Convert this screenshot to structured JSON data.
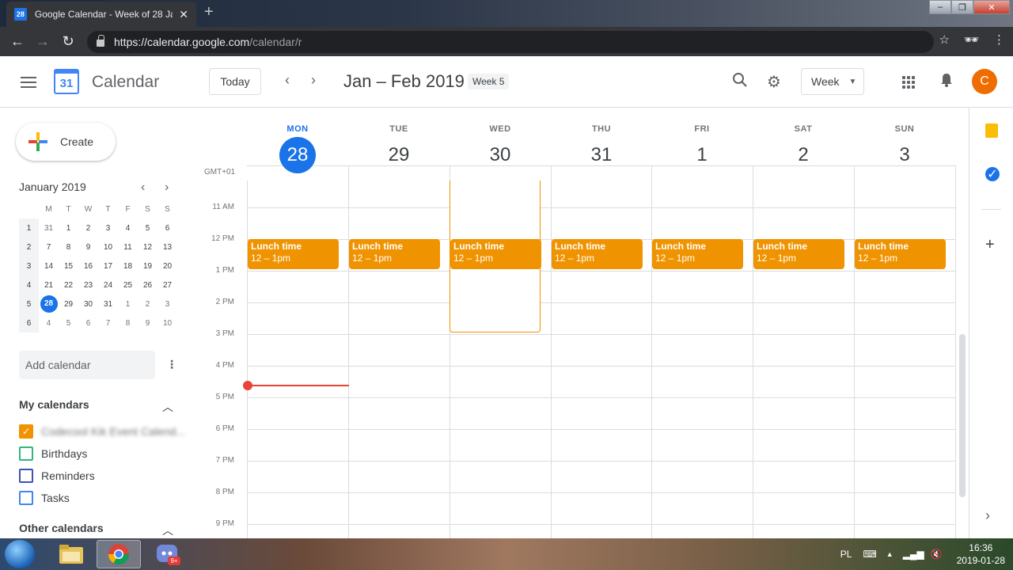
{
  "browser": {
    "tab_title": "Google Calendar - Week of 28 Ja",
    "favicon_text": "28",
    "url_host": "https://calendar.google.com",
    "url_path": "/calendar/r"
  },
  "header": {
    "app_name": "Calendar",
    "logo_day": "31",
    "today_label": "Today",
    "range_title": "Jan – Feb 2019",
    "week_badge": "Week 5",
    "view_label": "Week",
    "avatar_initial": "C"
  },
  "sidebar": {
    "create_label": "Create",
    "mini_title": "January 2019",
    "dow": [
      "M",
      "T",
      "W",
      "T",
      "F",
      "S",
      "S"
    ],
    "weeks": [
      {
        "wk": "1",
        "days": [
          "31",
          "1",
          "2",
          "3",
          "4",
          "5",
          "6"
        ]
      },
      {
        "wk": "2",
        "days": [
          "7",
          "8",
          "9",
          "10",
          "11",
          "12",
          "13"
        ]
      },
      {
        "wk": "3",
        "days": [
          "14",
          "15",
          "16",
          "17",
          "18",
          "19",
          "20"
        ]
      },
      {
        "wk": "4",
        "days": [
          "21",
          "22",
          "23",
          "24",
          "25",
          "26",
          "27"
        ]
      },
      {
        "wk": "5",
        "days": [
          "28",
          "29",
          "30",
          "31",
          "1",
          "2",
          "3"
        ]
      },
      {
        "wk": "6",
        "days": [
          "4",
          "5",
          "6",
          "7",
          "8",
          "9",
          "10"
        ]
      }
    ],
    "add_calendar_placeholder": "Add calendar",
    "my_calendars_title": "My calendars",
    "my_calendars": [
      {
        "label": "Codecool Kik Event Calend...",
        "color": "#f09300",
        "checked": true,
        "blurred": true
      },
      {
        "label": "Birthdays",
        "color": "#33b679",
        "checked": false,
        "blurred": false
      },
      {
        "label": "Reminders",
        "color": "#3f51b5",
        "checked": false,
        "blurred": false
      },
      {
        "label": "Tasks",
        "color": "#4285f4",
        "checked": false,
        "blurred": false
      }
    ],
    "other_calendars_title": "Other calendars"
  },
  "week": {
    "timezone_label": "GMT+01",
    "days": [
      {
        "name": "MON",
        "num": "28",
        "today": true
      },
      {
        "name": "TUE",
        "num": "29",
        "today": false
      },
      {
        "name": "WED",
        "num": "30",
        "today": false
      },
      {
        "name": "THU",
        "num": "31",
        "today": false
      },
      {
        "name": "FRI",
        "num": "1",
        "today": false
      },
      {
        "name": "SAT",
        "num": "2",
        "today": false
      },
      {
        "name": "SUN",
        "num": "3",
        "today": false
      }
    ],
    "hours": [
      "11 AM",
      "12 PM",
      "1 PM",
      "2 PM",
      "3 PM",
      "4 PM",
      "5 PM",
      "6 PM",
      "7 PM",
      "8 PM",
      "9 PM"
    ],
    "events": [
      {
        "title": "Lunch time",
        "time": "12 – 1pm",
        "day": 0
      },
      {
        "title": "Lunch time",
        "time": "12 – 1pm",
        "day": 1
      },
      {
        "title": "Lunch time",
        "time": "12 – 1pm",
        "day": 2
      },
      {
        "title": "Lunch time",
        "time": "12 – 1pm",
        "day": 3
      },
      {
        "title": "Lunch time",
        "time": "12 – 1pm",
        "day": 4
      },
      {
        "title": "Lunch time",
        "time": "12 – 1pm",
        "day": 5
      },
      {
        "title": "Lunch time",
        "time": "12 – 1pm",
        "day": 6
      }
    ],
    "event_color": "#f09300",
    "now_color": "#ea4335"
  },
  "taskbar": {
    "lang": "PL",
    "time": "16:36",
    "date": "2019-01-28",
    "discord_badge": "9+"
  },
  "icons": {
    "back": "←",
    "forward": "→",
    "reload": "↻",
    "star": "☆",
    "more": "⋮",
    "search": "🔍",
    "settings": "⚙",
    "bell": "🔔",
    "chev_left": "‹",
    "chev_right": "›",
    "caret_up": "⌃",
    "plus": "+",
    "close": "✕",
    "check": "✓"
  }
}
